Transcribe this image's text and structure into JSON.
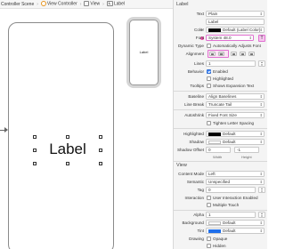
{
  "breadcrumb": {
    "items": [
      "Controller Scene",
      "View Controller",
      "View",
      "Label"
    ]
  },
  "canvas": {
    "label_text": "Label",
    "mini_label_text": "Label"
  },
  "inspector": {
    "title": "Label",
    "text_label": "Text",
    "text_value": "Plain",
    "text_content": "Label",
    "color_label": "Color",
    "color_value": "Default (Label Color)",
    "font_label": "Font",
    "font_value": "System 48.0",
    "font_button": "T",
    "dynamic_type_label": "Dynamic Type",
    "dynamic_type_value": "Automatically Adjusts Font",
    "alignment_label": "Alignment",
    "lines_label": "Lines",
    "lines_value": "1",
    "behavior_label": "Behavior",
    "behavior_enabled": "Enabled",
    "behavior_highlighted": "Highlighted",
    "tooltips_label": "Tooltips",
    "tooltips_value": "Shows Expansion Text",
    "baseline_label": "Baseline",
    "baseline_value": "Align Baselines",
    "line_break_label": "Line Break",
    "line_break_value": "Truncate Tail",
    "autoshrink_label": "Autoshrink",
    "autoshrink_value": "Fixed Font Size",
    "tighten_label": "Tighten Letter Spacing",
    "highlighted_label": "Highlighted",
    "highlighted_value": "Default",
    "shadow_label": "Shadow",
    "shadow_value": "Default",
    "shadow_offset_label": "Shadow Offset",
    "shadow_offset_w": "0",
    "shadow_offset_h": "-1",
    "width_label": "Width",
    "height_label": "Height"
  },
  "view_section": {
    "title": "View",
    "content_mode_label": "Content Mode",
    "content_mode_value": "Left",
    "semantic_label": "Semantic",
    "semantic_value": "Unspecified",
    "tag_label": "Tag",
    "tag_value": "0",
    "interaction_label": "Interaction",
    "interaction_user": "User Interaction Enabled",
    "interaction_multi": "Multiple Touch",
    "alpha_label": "Alpha",
    "alpha_value": "1",
    "background_label": "Background",
    "background_value": "Default",
    "tint_label": "Tint",
    "tint_value": "Default",
    "drawing_label": "Drawing",
    "drawing_opaque": "Opaque",
    "drawing_hidden": "Hidden"
  },
  "colors": {
    "highlight": "#e070d0",
    "accent_blue": "#3b82f6"
  }
}
